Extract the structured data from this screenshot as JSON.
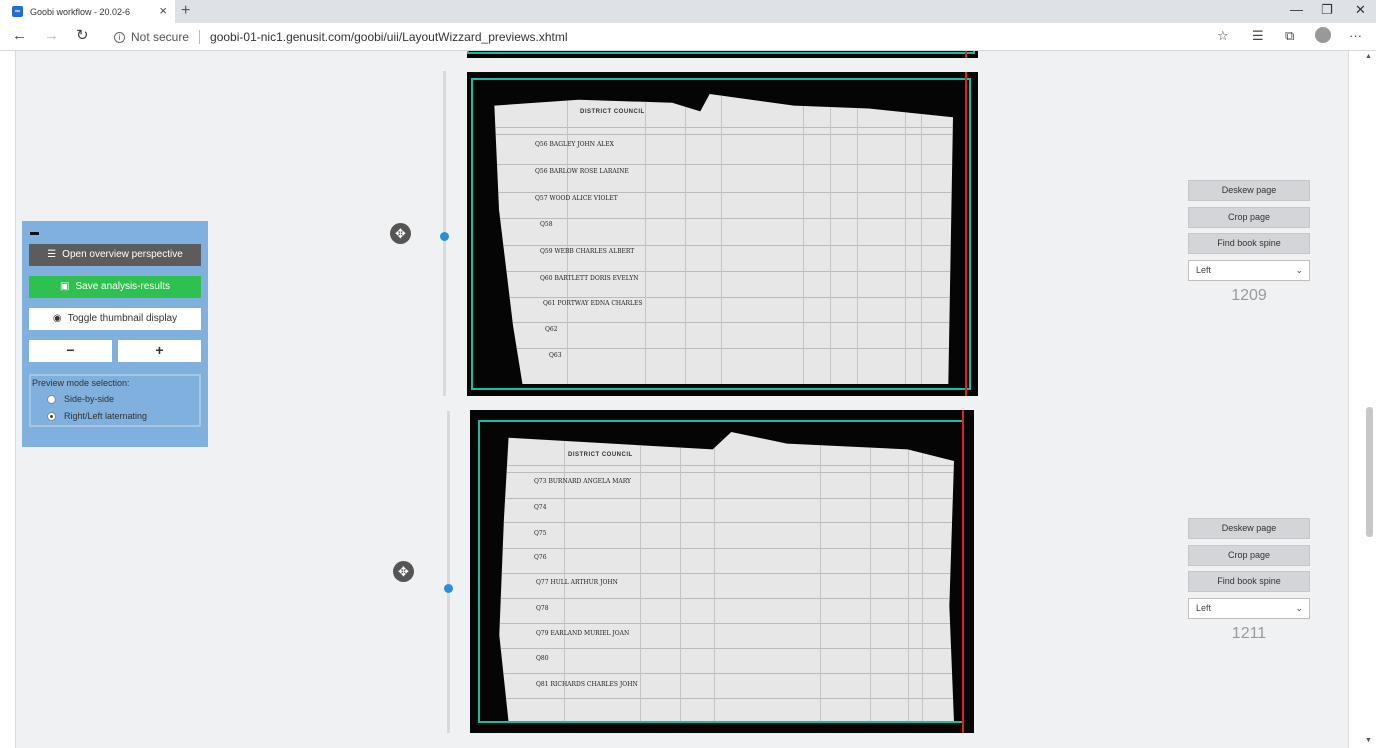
{
  "browser": {
    "tab_title": "Goobi workflow - 20.02-6",
    "favicon_text": "∞",
    "new_tab": "+",
    "security_label": "Not secure",
    "url": "goobi-01-nic1.genusit.com/goobi/uii/LayoutWizzard_previews.xhtml"
  },
  "panel": {
    "overview_label": "Open overview perspective",
    "save_label": "Save analysis-results",
    "thumbnail_label": "Toggle thumbnail display",
    "zoom_out": "−",
    "zoom_in": "+",
    "mode_title": "Preview mode selection:",
    "mode_options": [
      {
        "label": "Side-by-side",
        "selected": false
      },
      {
        "label": "Right/Left laternating",
        "selected": true
      }
    ]
  },
  "pages": [
    {
      "deskew_label": "Deskew page",
      "crop_label": "Crop page",
      "spine_label": "Find book spine",
      "side_value": "Left",
      "page_number": "1209",
      "sheet_title": "DISTRICT COUNCIL",
      "entries": [
        "Q56 BAGLEY JOHN ALEX",
        "Q56 BARLOW ROSE LARAINE",
        "Q57 WOOD ALICE VIOLET",
        "Q58",
        "Q59 WEBB CHARLES ALBERT",
        "Q60 BARTLETT DORIS EVELYN",
        "Q61 PORTWAY EDNA CHARLES",
        "Q62",
        "Q63"
      ]
    },
    {
      "deskew_label": "Deskew page",
      "crop_label": "Crop page",
      "spine_label": "Find book spine",
      "side_value": "Left",
      "page_number": "1211",
      "sheet_title": "DISTRICT COUNCIL",
      "entries": [
        "Q73 BURNARD ANGELA MARY",
        "Q74",
        "Q75",
        "Q76",
        "Q77 HULL ARTHUR JOHN",
        "Q78",
        "Q79 EARLAND MURIEL JOAN",
        "Q80",
        "Q81 RICHARDS CHARLES JOHN"
      ]
    }
  ],
  "colors": {
    "panel_bg": "#7fb0de",
    "save_green": "#2ec14f",
    "frame_teal": "#1abc9c",
    "spine_red": "#e02020"
  },
  "icons": {
    "move": "move-arrows-icon",
    "list": "list-icon",
    "save": "save-icon",
    "eye": "eye-icon"
  }
}
